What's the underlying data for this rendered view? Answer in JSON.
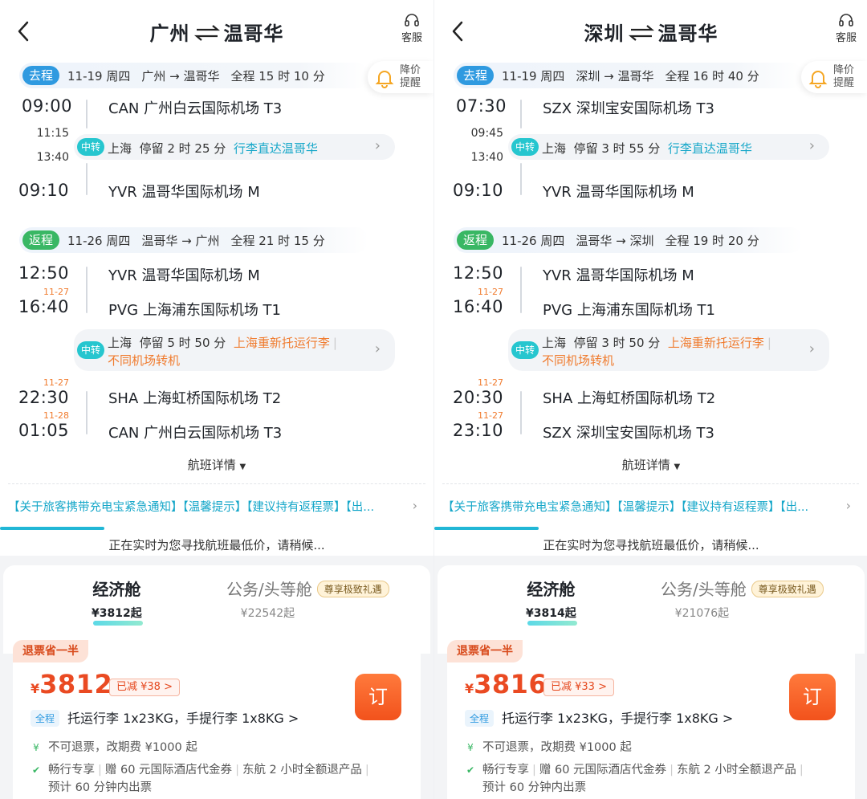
{
  "panels": [
    {
      "header": {
        "from": "广州",
        "to": "温哥华",
        "service": "客服"
      },
      "alert": {
        "line1": "降价",
        "line2": "提醒"
      },
      "outbound": {
        "tag": "去程",
        "date": "11-19 周四",
        "route": "广州 → 温哥华",
        "duration": "全程 15 时 10 分",
        "dep_time": "09:00",
        "dep_airport": "CAN 广州白云国际机场 T3",
        "transfer": {
          "arr": "11:15",
          "dep": "13:40",
          "tag": "中转",
          "city": "上海",
          "stay": "停留 2 时 25 分",
          "note": "行李直达温哥华"
        },
        "arr_time": "09:10",
        "arr_airport": "YVR 温哥华国际机场 M"
      },
      "inbound": {
        "tag": "返程",
        "date": "11-26 周四",
        "route": "温哥华 → 广州",
        "duration": "全程 21 时 15 分",
        "leg1": {
          "dep_time": "12:50",
          "dep_airport": "YVR 温哥华国际机场 M",
          "arr_day": "11-27",
          "arr_time": "16:40",
          "arr_airport": "PVG 上海浦东国际机场 T1"
        },
        "transfer": {
          "tag": "中转",
          "city": "上海",
          "stay": "停留 5 时 50 分",
          "note1": "上海重新托运行李",
          "note2": "不同机场转机"
        },
        "leg2": {
          "dep_day": "11-27",
          "dep_time": "22:30",
          "dep_airport": "SHA 上海虹桥国际机场 T2",
          "arr_day": "11-28",
          "arr_time": "01:05",
          "arr_airport": "CAN 广州白云国际机场 T3"
        }
      },
      "details": "航班详情",
      "notice": "【关于旅客携带充电宝紧急通知】【温馨提示】【建议持有返程票】【出...",
      "searching": "正在实时为您寻找航班最低价，请稍候...",
      "cabins": {
        "economy": {
          "name": "经济舱",
          "price": "¥3812起"
        },
        "business": {
          "name": "公务/头等舱",
          "badge": "尊享极致礼遇",
          "price": "¥22542起"
        }
      },
      "offer": {
        "ribbon": "退票省一半",
        "currency": "¥",
        "price": "3812",
        "reduced": "已减 ¥38 >",
        "book": "订",
        "chip": "全程",
        "baggage": "托运行李 1x23KG，手提行李 1x8KG >",
        "refund": "不可退票，改期费 ¥1000 起",
        "perks1": "畅行专享",
        "perks2": "赠 60 元国际酒店代金券",
        "perks3": "东航 2 小时全额退产品",
        "perks4": "预计 60 分钟内出票"
      }
    },
    {
      "header": {
        "from": "深圳",
        "to": "温哥华",
        "service": "客服"
      },
      "alert": {
        "line1": "降价",
        "line2": "提醒"
      },
      "outbound": {
        "tag": "去程",
        "date": "11-19 周四",
        "route": "深圳 → 温哥华",
        "duration": "全程 16 时 40 分",
        "dep_time": "07:30",
        "dep_airport": "SZX 深圳宝安国际机场 T3",
        "transfer": {
          "arr": "09:45",
          "dep": "13:40",
          "tag": "中转",
          "city": "上海",
          "stay": "停留 3 时 55 分",
          "note": "行李直达温哥华"
        },
        "arr_time": "09:10",
        "arr_airport": "YVR 温哥华国际机场 M"
      },
      "inbound": {
        "tag": "返程",
        "date": "11-26 周四",
        "route": "温哥华 → 深圳",
        "duration": "全程 19 时 20 分",
        "leg1": {
          "dep_time": "12:50",
          "dep_airport": "YVR 温哥华国际机场 M",
          "arr_day": "11-27",
          "arr_time": "16:40",
          "arr_airport": "PVG 上海浦东国际机场 T1"
        },
        "transfer": {
          "tag": "中转",
          "city": "上海",
          "stay": "停留 3 时 50 分",
          "note1": "上海重新托运行李",
          "note2": "不同机场转机"
        },
        "leg2": {
          "dep_day": "11-27",
          "dep_time": "20:30",
          "dep_airport": "SHA 上海虹桥国际机场 T2",
          "arr_day": "11-27",
          "arr_time": "23:10",
          "arr_airport": "SZX 深圳宝安国际机场 T3"
        }
      },
      "details": "航班详情",
      "notice": "【关于旅客携带充电宝紧急通知】【温馨提示】【建议持有返程票】【出...",
      "searching": "正在实时为您寻找航班最低价，请稍候...",
      "cabins": {
        "economy": {
          "name": "经济舱",
          "price": "¥3814起"
        },
        "business": {
          "name": "公务/头等舱",
          "badge": "尊享极致礼遇",
          "price": "¥21076起"
        }
      },
      "offer": {
        "ribbon": "退票省一半",
        "currency": "¥",
        "price": "3816",
        "reduced": "已减 ¥33 >",
        "book": "订",
        "chip": "全程",
        "baggage": "托运行李 1x23KG，手提行李 1x8KG >",
        "refund": "不可退票，改期费 ¥1000 起",
        "perks1": "畅行专享",
        "perks2": "赠 60 元国际酒店代金券",
        "perks3": "东航 2 小时全额退产品",
        "perks4": "预计 60 分钟内出票"
      }
    }
  ],
  "colors": {
    "accent_blue": "#2f9ae0",
    "accent_teal": "#26c6cf",
    "return_green": "#39b764",
    "price_orange": "#ea4a22"
  }
}
